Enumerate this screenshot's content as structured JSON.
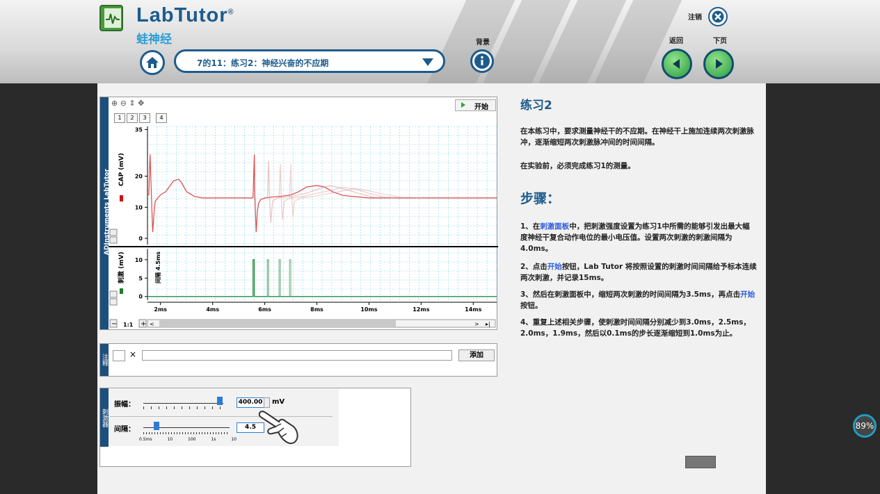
{
  "app": {
    "brand": "LabTutor",
    "registered": "®",
    "module": "蛙神经"
  },
  "header": {
    "selector_value": "7的11：练习2：神经兴奋的不应期",
    "background_label": "背景",
    "logout_label": "注销",
    "back_label": "返回",
    "next_label": "下页"
  },
  "chart_panel": {
    "side_label": "ADInstruments LabTutor",
    "start_label": "开始",
    "channel_tabs": [
      "1",
      "2",
      "3",
      "4"
    ],
    "top_ylabel": "CAP (mV)",
    "bottom_ylabel": "刺激 (mV)",
    "interval_label": "间隔 4.5ms",
    "zoom_label": "1:1"
  },
  "chart_data": [
    {
      "type": "line",
      "ylabel": "CAP (mV)",
      "xlim": [
        1.5,
        14.9
      ],
      "ylim": [
        -2,
        36
      ],
      "yticks": [
        0,
        10,
        20,
        35
      ],
      "xticks": [
        "2ms",
        "4ms",
        "6ms",
        "8ms",
        "10ms",
        "12ms",
        "14ms"
      ],
      "series": [
        {
          "x": [
            1.5,
            1.55,
            1.6,
            1.65,
            1.7,
            1.75,
            1.8,
            1.9,
            2.0,
            2.2,
            2.5,
            2.7,
            2.8,
            3.0,
            3.3,
            3.6,
            4.0,
            5.0,
            5.55
          ],
          "y": [
            14,
            14,
            27,
            14,
            2,
            8,
            12,
            13,
            14,
            15,
            18.5,
            19,
            18,
            15,
            13.5,
            13,
            13,
            13,
            13
          ]
        },
        {
          "x": [
            5.55,
            5.6,
            5.62,
            5.67,
            5.72,
            5.77,
            5.85,
            6.0,
            6.3,
            6.6,
            7.0,
            7.3,
            7.6,
            8.0,
            8.3,
            8.6,
            9.0,
            10.0,
            14.9
          ],
          "y": [
            13,
            27,
            14,
            2,
            9,
            11.5,
            12.5,
            13,
            13.3,
            13.5,
            14,
            15,
            16.5,
            17,
            16.5,
            15,
            13.8,
            13,
            13
          ]
        },
        {
          "x": [
            6.1,
            6.15,
            6.18,
            6.23,
            6.3,
            6.5,
            7.0,
            7.6,
            8.1,
            8.5,
            9.0,
            9.6,
            10.2,
            11.0
          ],
          "y": [
            13,
            25,
            13.5,
            5,
            12,
            13,
            13.5,
            14.5,
            16,
            17,
            16,
            14.5,
            13.2,
            13
          ]
        },
        {
          "x": [
            6.55,
            6.6,
            6.63,
            6.68,
            6.75,
            7.0,
            7.5,
            8.0,
            8.6,
            9.0,
            9.5,
            10.0,
            10.6,
            11.4
          ],
          "y": [
            13,
            24,
            13.5,
            6,
            12,
            13,
            13.5,
            14.5,
            15.5,
            16.5,
            15.8,
            14.5,
            13.3,
            13
          ]
        },
        {
          "x": [
            6.95,
            7.0,
            7.03,
            7.08,
            7.15,
            7.4,
            7.9,
            8.4,
            9.0,
            9.5,
            10.0,
            10.6,
            11.2,
            12.0
          ],
          "y": [
            13,
            24,
            13.5,
            7,
            12,
            13,
            13.5,
            14.3,
            15.3,
            16,
            15.3,
            14.2,
            13.3,
            13
          ]
        }
      ]
    },
    {
      "type": "line",
      "ylabel": "刺激 (mV)",
      "xlim": [
        1.5,
        14.9
      ],
      "ylim": [
        -1,
        13
      ],
      "yticks": [
        0,
        5,
        10
      ],
      "series": [
        {
          "x": [
            1.5,
            5.55,
            5.55,
            5.6,
            5.6,
            14.9
          ],
          "y": [
            0,
            0,
            10,
            10,
            0,
            0
          ]
        },
        {
          "x": [
            6.1,
            6.1,
            6.15,
            6.15
          ],
          "y": [
            0,
            10,
            10,
            0
          ]
        },
        {
          "x": [
            6.55,
            6.55,
            6.6,
            6.6
          ],
          "y": [
            0,
            10,
            10,
            0
          ]
        },
        {
          "x": [
            6.95,
            6.95,
            7.0,
            7.0
          ],
          "y": [
            0,
            10,
            10,
            0
          ]
        }
      ]
    }
  ],
  "notes": {
    "side_label": "注释",
    "close_symbol": "×",
    "add_label": "添加"
  },
  "stimulator": {
    "side_label": "刺激器",
    "amplitude_label": "振幅：",
    "amplitude_value": "400.00",
    "amplitude_unit": "mV",
    "interval_label": "间隔：",
    "interval_value": "4.5",
    "interval_scale": [
      "0.5ms",
      "10",
      "100",
      "1s",
      "10"
    ]
  },
  "instructions": {
    "title": "练习2",
    "intro": "在本练习中，要求测量神经干的不应期。在神经干上施加连续两次刺激脉冲，逐渐缩短两次刺激脉冲间的时间间隔。",
    "note": "在实验前，必须完成练习1的测量。",
    "steps_title": "步骤：",
    "step1_a": "1、在",
    "step1_link": "刺激面板",
    "step1_b": "中，把刺激强度设置为练习1中所需的能够引发出最大幅度神经干复合动作电位的最小电压值。设置两次刺激的刺激间隔为4.0ms。",
    "step2_a": "2、点击",
    "step2_link": "开始",
    "step2_b": "按钮，Lab Tutor 将按照设置的刺激时间间隔给予标本连续两次刺激，并记录15ms。",
    "step3_a": "3、然后在刺激面板中，缩短两次刺激的时间间隔为3.5ms，再点击",
    "step3_link": "开始",
    "step3_b": "按钮。",
    "step4": "4、重复上述相关步骤，使刺激时间间隔分别减少到3.0ms，2.5ms，2.0ms，1.9ms，然后以0.1ms的步长逐渐缩短到1.0ms为止。"
  },
  "status": {
    "percent": "89%"
  },
  "colors": {
    "brand": "#1d5b8c",
    "cap_trace": "#e05050",
    "stim_trace": "#2f8f4a",
    "nav_green": "#3cb04e"
  }
}
